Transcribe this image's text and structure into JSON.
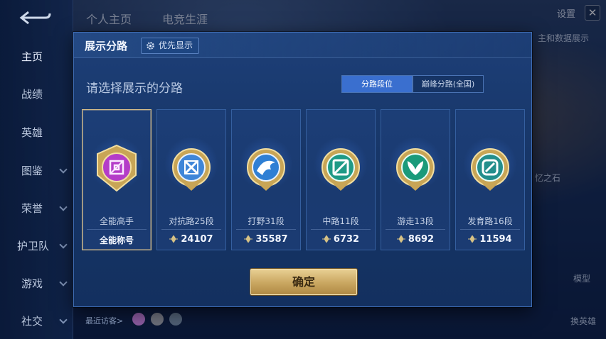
{
  "header": {
    "tabs": [
      {
        "label": "个人主页"
      },
      {
        "label": "电竞生涯"
      }
    ],
    "settings_label": "设置",
    "close_glyph": "✕"
  },
  "sidebar": {
    "items": [
      {
        "label": "主页",
        "active": true
      },
      {
        "label": "战绩"
      },
      {
        "label": "英雄"
      },
      {
        "label": "图鉴"
      },
      {
        "label": "荣誉"
      },
      {
        "label": "护卫队"
      },
      {
        "label": "游戏"
      },
      {
        "label": "社交"
      }
    ]
  },
  "background": {
    "right_text_1": "主和数据展示",
    "right_text_2": "忆之石",
    "right_btn_1": "模型",
    "right_btn_2": "换英雄",
    "visitors_label": "最近访客>"
  },
  "dialog": {
    "title": "展示分路",
    "priority_label": "优先显示",
    "subtitle": "请选择展示的分路",
    "segments": [
      {
        "label": "分路段位",
        "active": true
      },
      {
        "label": "巅峰分路(全国)",
        "active": false
      }
    ],
    "cards": [
      {
        "name": "全能高手",
        "stat": "全能称号",
        "emblem": "all-round",
        "color": "#b43cc8",
        "selected": true
      },
      {
        "name": "对抗路25段",
        "stat": "24107",
        "emblem": "clash-lane",
        "color": "#3f86d8"
      },
      {
        "name": "打野31段",
        "stat": "35587",
        "emblem": "jungle",
        "color": "#2f7fd4"
      },
      {
        "name": "中路11段",
        "stat": "6732",
        "emblem": "mid-lane",
        "color": "#1f9a86"
      },
      {
        "name": "游走13段",
        "stat": "8692",
        "emblem": "roam",
        "color": "#1a9a7a"
      },
      {
        "name": "发育路16段",
        "stat": "11594",
        "emblem": "farm-lane",
        "color": "#238e8c"
      }
    ],
    "confirm_label": "确定"
  },
  "colors": {
    "accent_blue": "#3a6fcf",
    "gold": "#c9a660",
    "dialog_bg": "#173668"
  }
}
